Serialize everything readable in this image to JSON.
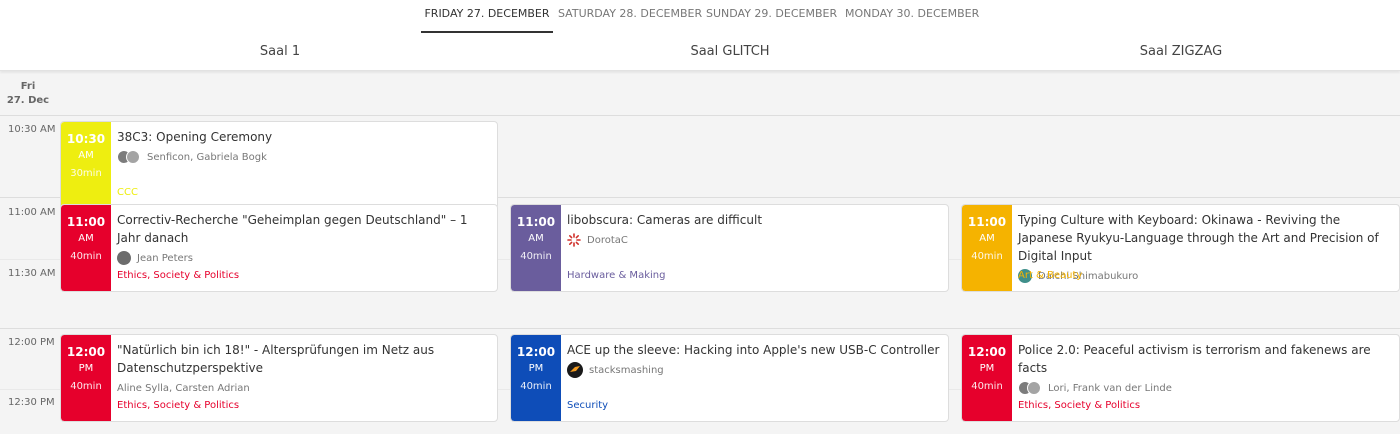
{
  "days": [
    {
      "label": "FRIDAY 27. DECEMBER",
      "active": true
    },
    {
      "label": "SATURDAY 28. DECEMBER",
      "active": false
    },
    {
      "label": "SUNDAY 29. DECEMBER",
      "active": false
    },
    {
      "label": "MONDAY 30. DECEMBER",
      "active": false
    }
  ],
  "rooms": [
    "Saal 1",
    "Saal GLITCH",
    "Saal ZIGZAG"
  ],
  "day_label": {
    "line1": "Fri",
    "line2": "27. Dec"
  },
  "times": [
    "10:30 AM",
    "11:00 AM",
    "11:30 AM",
    "12:00 PM",
    "12:30 PM"
  ],
  "colors": {
    "ccc": "#eeee10",
    "ethics": "#e6002c",
    "hardware": "#6a5d9d",
    "art": "#f5b300",
    "security": "#0e4db8"
  },
  "events": [
    {
      "id": "opening",
      "time": "10:30",
      "ampm": "AM",
      "duration": "30min",
      "title": "38C3: Opening Ceremony",
      "speakers": "Senficon, Gabriela Bogk",
      "track": "CCC",
      "track_color": "#eeee10",
      "avatar": "double"
    },
    {
      "id": "correctiv",
      "time": "11:00",
      "ampm": "AM",
      "duration": "40min",
      "title": "Correctiv-Recherche \"Geheimplan gegen Deutschland\" – 1 Jahr danach",
      "speakers": "Jean Peters",
      "track": "Ethics, Society & Politics",
      "track_color": "#e6002c",
      "avatar": "person"
    },
    {
      "id": "libobscura",
      "time": "11:00",
      "ampm": "AM",
      "duration": "40min",
      "title": "libobscura: Cameras are difficult",
      "speakers": "DorotaC",
      "track": "Hardware & Making",
      "track_color": "#6a5d9d",
      "avatar": "sparkle"
    },
    {
      "id": "typing",
      "time": "11:00",
      "ampm": "AM",
      "duration": "40min",
      "title": "Typing Culture with Keyboard: Okinawa - Reviving the Japanese Ryukyu-Language through the Art and Precision of Digital Input",
      "speakers": "Daichi Shimabukuro",
      "track": "Art & Beauty",
      "track_color": "#f5b300",
      "avatar": "person-teal"
    },
    {
      "id": "natuerlich",
      "time": "12:00",
      "ampm": "PM",
      "duration": "40min",
      "title": "\"Natürlich bin ich 18!\" - Altersprüfungen im Netz aus Datenschutzperspektive",
      "speakers": "Aline Sylla, Carsten Adrian",
      "track": "Ethics, Society & Politics",
      "track_color": "#e6002c",
      "avatar": "none"
    },
    {
      "id": "ace",
      "time": "12:00",
      "ampm": "PM",
      "duration": "40min",
      "title": "ACE up the sleeve: Hacking into Apple's new USB-C Controller",
      "speakers": "stacksmashing",
      "track": "Security",
      "track_color": "#0e4db8",
      "avatar": "logo"
    },
    {
      "id": "police",
      "time": "12:00",
      "ampm": "PM",
      "duration": "40min",
      "title": "Police 2.0: Peaceful activism is terrorism and fakenews are facts",
      "speakers": "Lori, Frank van der Linde",
      "track": "Ethics, Society & Politics",
      "track_color": "#e6002c",
      "avatar": "double"
    }
  ]
}
